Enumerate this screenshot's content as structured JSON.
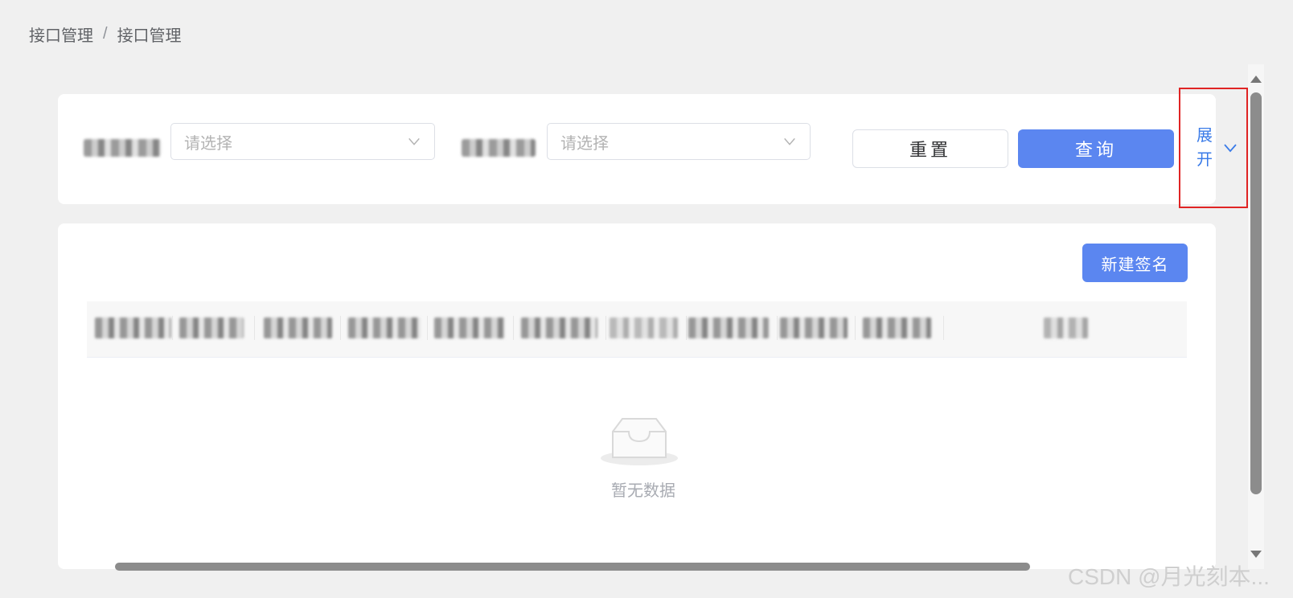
{
  "breadcrumb": {
    "items": [
      "接口管理",
      "接口管理"
    ],
    "separator": "/"
  },
  "filters": {
    "select1": {
      "placeholder": "请选择"
    },
    "select2": {
      "placeholder": "请选择"
    },
    "reset_label": "重置",
    "query_label": "查询",
    "expand_label": "展开"
  },
  "table": {
    "new_button_label": "新建签名",
    "empty_text": "暂无数据"
  },
  "watermark": "CSDN @月光刻本...",
  "colors": {
    "primary": "#5b86f0",
    "link": "#3a7be8",
    "highlight_border": "#e02424"
  }
}
